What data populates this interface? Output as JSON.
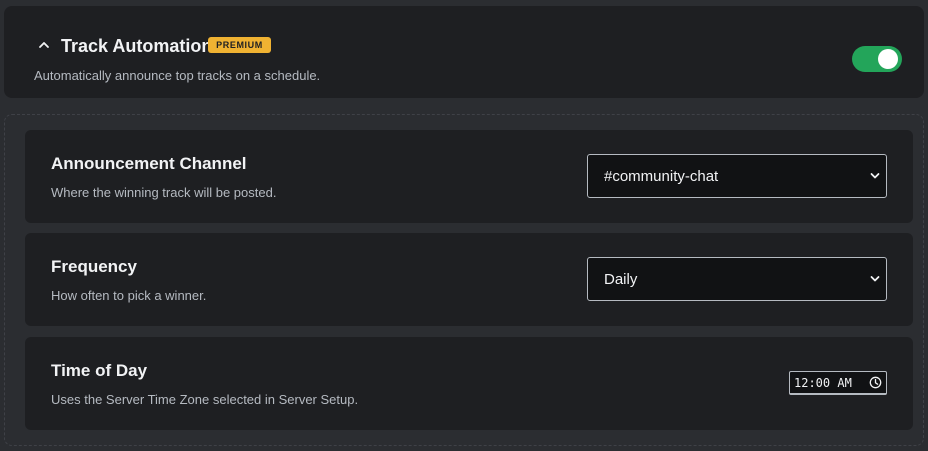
{
  "header": {
    "title": "Track Automation",
    "badge": "PREMIUM",
    "subtitle": "Automatically announce top tracks on a schedule.",
    "toggle_on": true,
    "chevron_icon": "chevron-up-icon",
    "colors": {
      "badge": "#f0b232",
      "toggle": "#23a55a",
      "card": "#1e1f22",
      "background": "#2b2d31"
    }
  },
  "settings": {
    "channel": {
      "label": "Announcement Channel",
      "description": "Where the winning track will be posted.",
      "value": "#community-chat"
    },
    "frequency": {
      "label": "Frequency",
      "description": "How often to pick a winner.",
      "value": "Daily"
    },
    "time": {
      "label": "Time of Day",
      "description": "Uses the Server Time Zone selected in Server Setup.",
      "value": "12:00 AM",
      "icon": "clock-icon"
    }
  }
}
